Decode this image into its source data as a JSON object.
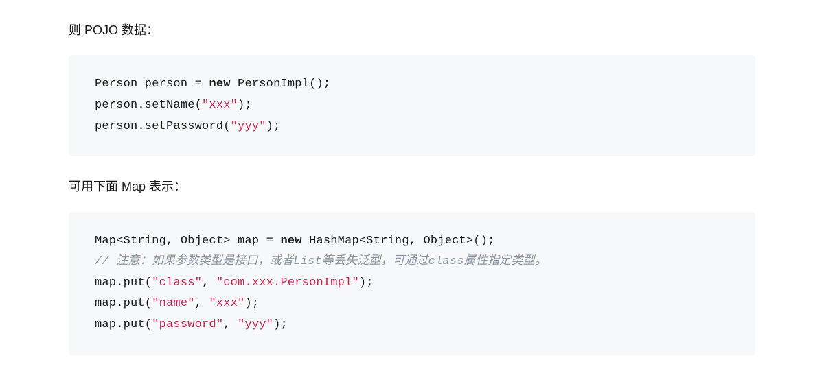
{
  "paragraphs": {
    "p1": "则 POJO 数据：",
    "p2": "可用下面 Map 表示："
  },
  "code1": {
    "lines": [
      [
        {
          "t": "Person person = ",
          "c": "normal"
        },
        {
          "t": "new",
          "c": "keyword"
        },
        {
          "t": " PersonImpl();",
          "c": "normal"
        }
      ],
      [
        {
          "t": "person.setName(",
          "c": "normal"
        },
        {
          "t": "\"xxx\"",
          "c": "string"
        },
        {
          "t": ");",
          "c": "normal"
        }
      ],
      [
        {
          "t": "person.setPassword(",
          "c": "normal"
        },
        {
          "t": "\"yyy\"",
          "c": "string"
        },
        {
          "t": ");",
          "c": "normal"
        }
      ]
    ]
  },
  "code2": {
    "lines": [
      [
        {
          "t": "Map<String, Object> map = ",
          "c": "normal"
        },
        {
          "t": "new",
          "c": "keyword"
        },
        {
          "t": " HashMap<String, Object>();",
          "c": "normal"
        }
      ],
      [
        {
          "t": "// 注意：如果参数类型是接口，或者List等丢失泛型，可通过class属性指定类型。",
          "c": "comment"
        }
      ],
      [
        {
          "t": "map.put(",
          "c": "normal"
        },
        {
          "t": "\"class\"",
          "c": "string"
        },
        {
          "t": ", ",
          "c": "normal"
        },
        {
          "t": "\"com.xxx.PersonImpl\"",
          "c": "string"
        },
        {
          "t": ");",
          "c": "normal"
        }
      ],
      [
        {
          "t": "map.put(",
          "c": "normal"
        },
        {
          "t": "\"name\"",
          "c": "string"
        },
        {
          "t": ", ",
          "c": "normal"
        },
        {
          "t": "\"xxx\"",
          "c": "string"
        },
        {
          "t": ");",
          "c": "normal"
        }
      ],
      [
        {
          "t": "map.put(",
          "c": "normal"
        },
        {
          "t": "\"password\"",
          "c": "string"
        },
        {
          "t": ", ",
          "c": "normal"
        },
        {
          "t": "\"yyy\"",
          "c": "string"
        },
        {
          "t": ");",
          "c": "normal"
        }
      ]
    ]
  }
}
